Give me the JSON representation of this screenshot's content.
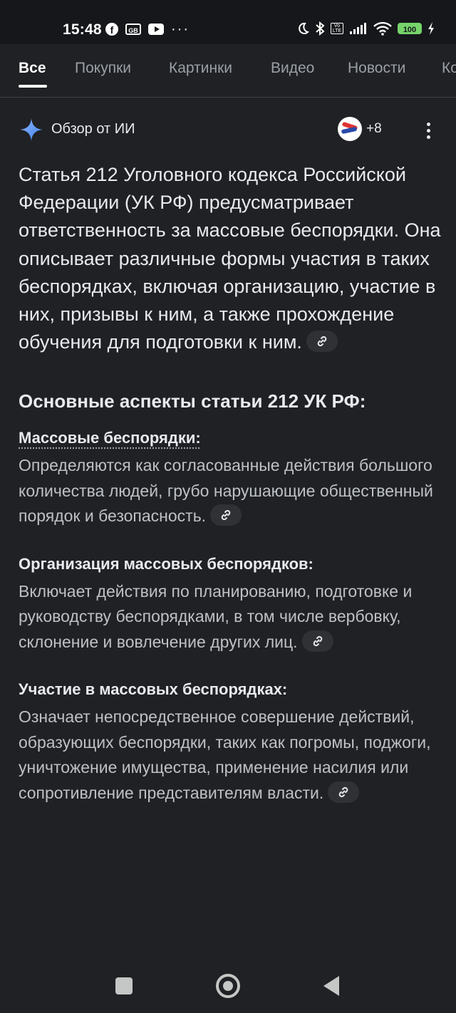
{
  "status_bar": {
    "time": "15:48",
    "left_icons": [
      "facebook-icon",
      "gb-icon",
      "youtube-icon",
      "more-icon"
    ],
    "right_icons": [
      "moon-icon",
      "bluetooth-icon",
      "volte-icon",
      "signal-icon",
      "wifi-icon",
      "battery-icon",
      "charging-icon"
    ],
    "battery": "100",
    "battery_color": "#76d36b",
    "gb_label": "GB",
    "volte_label": "Vo LTE"
  },
  "tabs": [
    {
      "label": "Все",
      "active": true
    },
    {
      "label": "Покупки",
      "active": false
    },
    {
      "label": "Картинки",
      "active": false
    },
    {
      "label": "Видео",
      "active": false
    },
    {
      "label": "Новости",
      "active": false
    },
    {
      "label": "Ко",
      "active": false
    }
  ],
  "ai_overview": {
    "title": "Обзор от ИИ",
    "sources_count": "+8",
    "accent_color": "#8ab4f8"
  },
  "content": {
    "intro": "Статья 212 Уголовного кодекса Российской Федерации (УК РФ) предусматривает ответственность за массовые беспорядки. Она описывает различные формы участия в таких беспорядках, включая организацию, участие в них, призывы к ним, а также прохождение обучения для подготовки к ним.",
    "section_title": "Основные аспекты статьи 212 УК РФ:",
    "items": [
      {
        "title": "Массовые беспорядки:",
        "body": "Определяются как согласованные действия большого количества людей, грубо нарушающие общественный порядок и безопасность."
      },
      {
        "title": "Организация массовых беспорядков:",
        "body": "Включает действия по планированию, подготовке и руководству беспорядками, в том числе вербовку, склонение и вовлечение других лиц."
      },
      {
        "title": "Участие в массовых беспорядках:",
        "body": "Означает непосредственное совершение действий, образующих беспорядки, таких как погромы, поджоги, уничтожение имущества, применение насилия или сопротивление представителям власти."
      }
    ]
  },
  "nav_bar": {
    "buttons": [
      "recents-button",
      "home-button",
      "back-button"
    ]
  }
}
